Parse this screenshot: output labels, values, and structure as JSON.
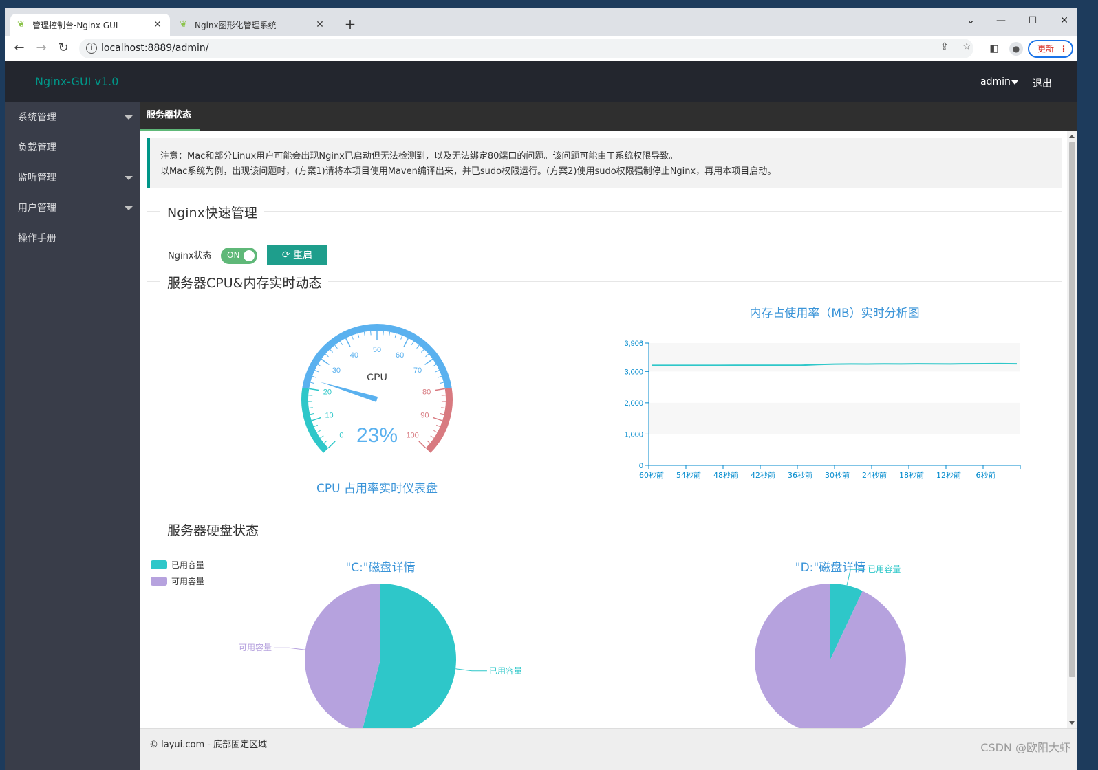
{
  "browser": {
    "tabs": [
      {
        "title": "管理控制台-Nginx GUI",
        "close": "✕"
      },
      {
        "title": "Nginx图形化管理系统",
        "close": "✕"
      }
    ],
    "new_tab": "+",
    "url": "localhost:8889/admin/",
    "update_label": "更新",
    "window_controls": {
      "minimize": "—",
      "maximize": "☐",
      "close": "✕",
      "dropdown": "⌄"
    }
  },
  "header": {
    "logo": "Nginx-GUI v1.0",
    "user": "admin",
    "logout": "退出"
  },
  "sidebar": {
    "items": [
      {
        "label": "系统管理",
        "has_children": true
      },
      {
        "label": "负载管理",
        "has_children": false
      },
      {
        "label": "监听管理",
        "has_children": true
      },
      {
        "label": "用户管理",
        "has_children": true
      },
      {
        "label": "操作手册",
        "has_children": false
      }
    ]
  },
  "main": {
    "tab": "服务器状态",
    "notice": {
      "line1": "注意：Mac和部分Linux用户可能会出现Nginx已启动但无法检测到，以及无法绑定80端口的问题。该问题可能由于系统权限导致。",
      "line2": "以Mac系统为例，出现该问题时，(方案1)请将本项目使用Maven编译出来，并已sudo权限运行。(方案2)使用sudo权限强制停止Nginx，再用本项目启动。"
    },
    "section_quick": "Nginx快速管理",
    "nginx_status_label": "Nginx状态",
    "switch_label": "ON",
    "restart_label": "重启",
    "section_cpu_mem": "服务器CPU&内存实时动态",
    "section_disk": "服务器硬盘状态"
  },
  "chart_data": [
    {
      "type": "gauge",
      "title": "CPU 占用率实时仪表盘",
      "center_label": "CPU",
      "value": 23,
      "value_text": "23%",
      "min": 0,
      "max": 100,
      "ticks": [
        0,
        10,
        20,
        30,
        40,
        50,
        60,
        70,
        80,
        90,
        100
      ],
      "colors": {
        "low": "#2ec7c9",
        "mid": "#5ab1ef",
        "high": "#d87a80"
      }
    },
    {
      "type": "line",
      "title": "内存占使用率（MB）实时分析图",
      "x": [
        "60秒前",
        "54秒前",
        "48秒前",
        "42秒前",
        "36秒前",
        "30秒前",
        "24秒前",
        "18秒前",
        "12秒前",
        "6秒前"
      ],
      "y_ticks": [
        0,
        1000,
        2000,
        3000,
        3906
      ],
      "y_tick_labels": [
        "0",
        "1,000",
        "2,000",
        "3,000",
        "3,906"
      ],
      "ylim": [
        0,
        3906
      ],
      "values": [
        3195,
        3195,
        3195,
        3196,
        3196,
        3197,
        3197,
        3198,
        3198,
        3197,
        3220,
        3235,
        3240,
        3238,
        3242,
        3240,
        3245,
        3243,
        3240,
        3246,
        3248,
        3250,
        3245
      ],
      "color": "#2ec7c9"
    },
    {
      "type": "pie",
      "title": "\"C:\"磁盘详情",
      "legend": [
        "已用容量",
        "可用容量"
      ],
      "slices": [
        {
          "label": "已用容量",
          "value": 54,
          "color": "#2ec7c9"
        },
        {
          "label": "可用容量",
          "value": 46,
          "color": "#b6a2de"
        }
      ]
    },
    {
      "type": "pie",
      "title": "\"D:\"磁盘详情",
      "slices": [
        {
          "label": "已用容量",
          "value": 7,
          "color": "#2ec7c9"
        },
        {
          "label": "可用容量",
          "value": 93,
          "color": "#b6a2de"
        }
      ]
    }
  ],
  "footer": {
    "text": "© layui.com - 底部固定区域",
    "watermark": "CSDN @欧阳大虾"
  }
}
